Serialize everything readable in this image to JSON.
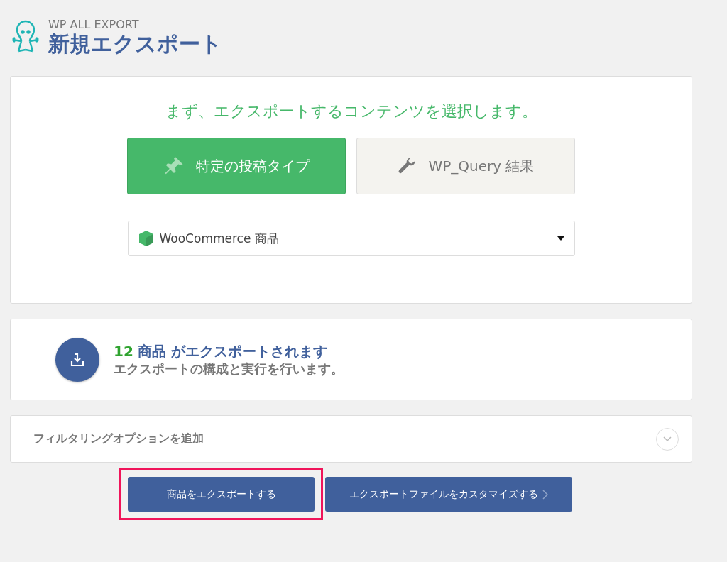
{
  "header": {
    "brand": "WP ALL EXPORT",
    "title": "新規エクスポート"
  },
  "content_card": {
    "heading": "まず、エクスポートするコンテンツを選択します。",
    "type_buttons": [
      {
        "kind": "pin",
        "label": "特定の投稿タイプ",
        "selected": true
      },
      {
        "kind": "wrench",
        "label": "WP_Query 結果",
        "selected": false
      }
    ],
    "post_type_select": {
      "value": "WooCommerce 商品"
    }
  },
  "summary_card": {
    "count": "12",
    "headline": "商品 がエクスポートされます",
    "subtitle": "エクスポートの構成と実行を行います。"
  },
  "filter_panel": {
    "label": "フィルタリングオプションを追加",
    "expanded": false
  },
  "actions": [
    {
      "kind": "export",
      "label": "商品をエクスポートする",
      "highlighted": true
    },
    {
      "kind": "customize",
      "label": "エクスポートファイルをカスタマイズする",
      "highlighted": false
    }
  ]
}
